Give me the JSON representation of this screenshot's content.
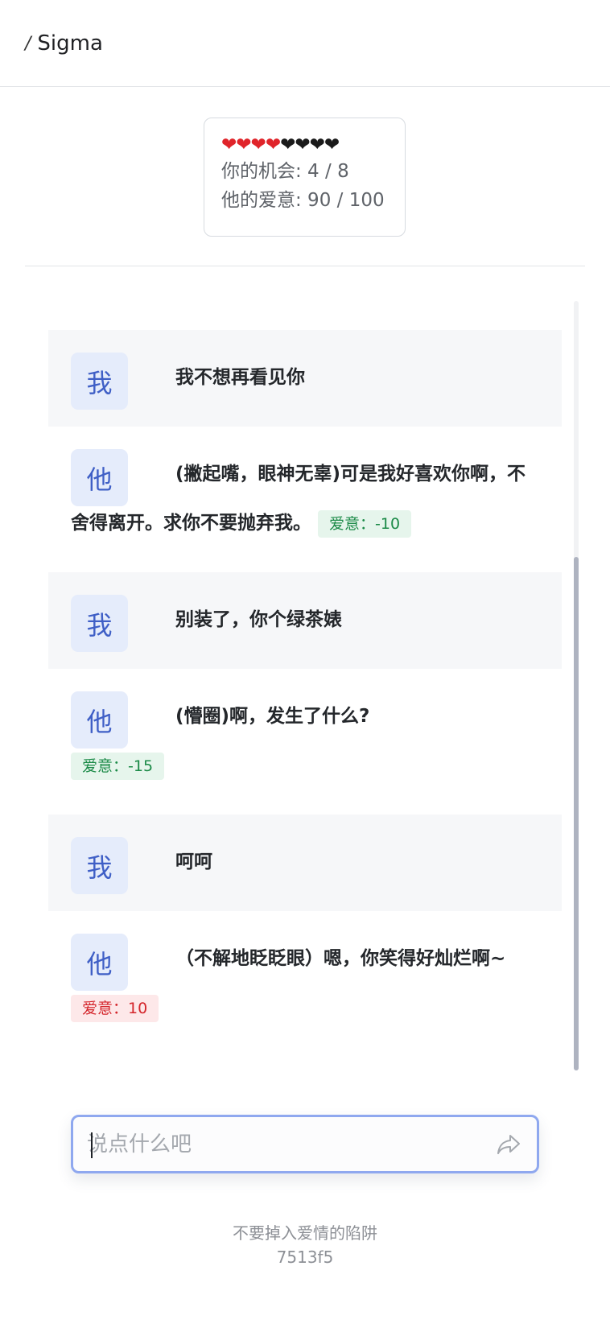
{
  "header": {
    "separator": "/",
    "title": "Sigma"
  },
  "status": {
    "hearts_red": "❤❤❤❤",
    "hearts_black": "❤❤❤❤",
    "chances_text": "你的机会: 4 / 8",
    "affection_text": "他的爱意: 90 / 100"
  },
  "messages": [
    {
      "role": "me",
      "avatar": "我",
      "text": "我不想再看见你"
    },
    {
      "role": "he",
      "avatar": "他",
      "text": "(撇起嘴，眼神无辜)可是我好喜欢你啊，不舍得离开。求你不要抛弃我。",
      "tag": "爱意：-10"
    },
    {
      "role": "me",
      "avatar": "我",
      "text": "别装了，你个绿茶婊"
    },
    {
      "role": "he",
      "avatar": "他",
      "text": "(懵圈)啊，发生了什么?",
      "tag": "爱意：-15"
    },
    {
      "role": "me",
      "avatar": "我",
      "text": "呵呵"
    },
    {
      "role": "he",
      "avatar": "他",
      "text": "（不解地眨眨眼）嗯，你笑得好灿烂啊~",
      "tag": "爱意：10"
    }
  ],
  "input": {
    "placeholder": "说点什么吧",
    "value": ""
  },
  "footer": {
    "slogan": "不要掉入爱情的陷阱",
    "version": "7513f5"
  },
  "colors": {
    "accent": "#8fa8ef",
    "avatar_bg": "#e5ecfb",
    "tag_negative": "#1b8a47",
    "tag_positive": "#d4252b"
  }
}
